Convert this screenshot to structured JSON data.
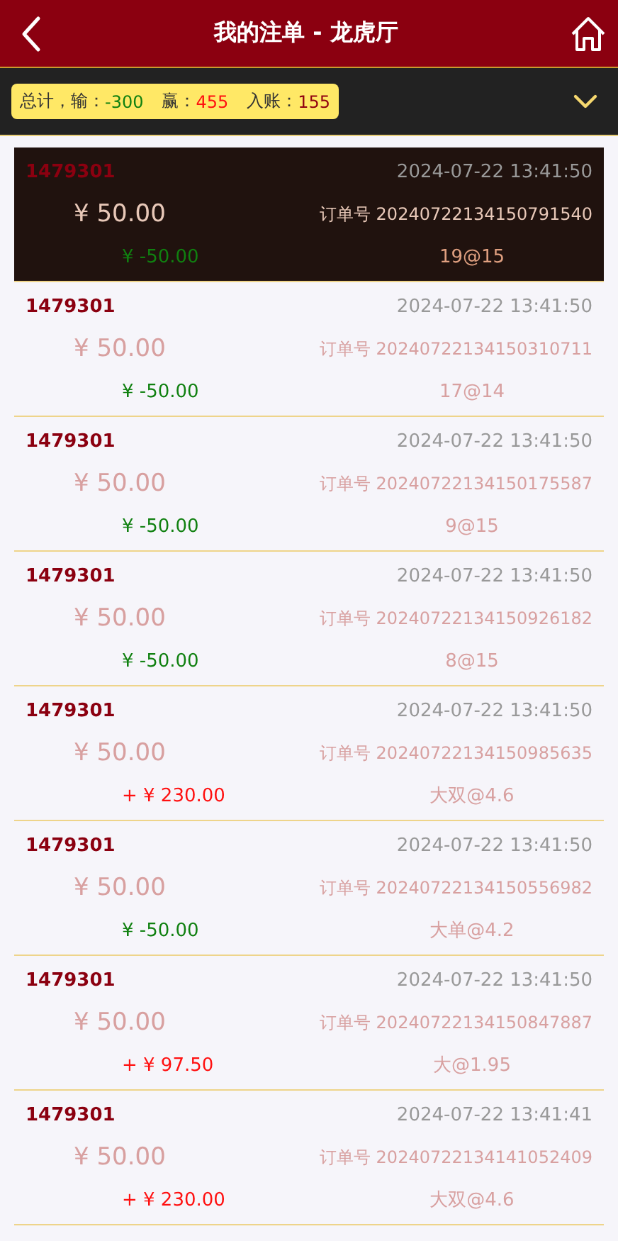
{
  "header": {
    "title": "我的注单 - 龙虎厅"
  },
  "summary": {
    "label": "总计，",
    "items": [
      {
        "label": "输：",
        "value": "-300",
        "kind": "loss"
      },
      {
        "label": "赢：",
        "value": "455",
        "kind": "win"
      },
      {
        "label": "入账：",
        "value": "155",
        "kind": "net"
      }
    ]
  },
  "orders": [
    {
      "user": "1479301",
      "time": "2024-07-22 13:41:50",
      "amount": "¥ 50.00",
      "order_no": "订单号 20240722134150791540",
      "result": "¥ -50.00",
      "kind": "loss",
      "bet": "19@15",
      "selected": true
    },
    {
      "user": "1479301",
      "time": "2024-07-22 13:41:50",
      "amount": "¥ 50.00",
      "order_no": "订单号 20240722134150310711",
      "result": "¥ -50.00",
      "kind": "loss",
      "bet": "17@14",
      "selected": false
    },
    {
      "user": "1479301",
      "time": "2024-07-22 13:41:50",
      "amount": "¥ 50.00",
      "order_no": "订单号 20240722134150175587",
      "result": "¥ -50.00",
      "kind": "loss",
      "bet": "9@15",
      "selected": false
    },
    {
      "user": "1479301",
      "time": "2024-07-22 13:41:50",
      "amount": "¥ 50.00",
      "order_no": "订单号 20240722134150926182",
      "result": "¥ -50.00",
      "kind": "loss",
      "bet": "8@15",
      "selected": false
    },
    {
      "user": "1479301",
      "time": "2024-07-22 13:41:50",
      "amount": "¥ 50.00",
      "order_no": "订单号 20240722134150985635",
      "result": "+ ¥ 230.00",
      "kind": "win",
      "bet": "大双@4.6",
      "selected": false
    },
    {
      "user": "1479301",
      "time": "2024-07-22 13:41:50",
      "amount": "¥ 50.00",
      "order_no": "订单号 20240722134150556982",
      "result": "¥ -50.00",
      "kind": "loss",
      "bet": "大单@4.2",
      "selected": false
    },
    {
      "user": "1479301",
      "time": "2024-07-22 13:41:50",
      "amount": "¥ 50.00",
      "order_no": "订单号 20240722134150847887",
      "result": "+ ¥ 97.50",
      "kind": "win",
      "bet": "大@1.95",
      "selected": false
    },
    {
      "user": "1479301",
      "time": "2024-07-22 13:41:41",
      "amount": "¥ 50.00",
      "order_no": "订单号 20240722134141052409",
      "result": "+ ¥ 230.00",
      "kind": "win",
      "bet": "大双@4.6",
      "selected": false
    }
  ]
}
